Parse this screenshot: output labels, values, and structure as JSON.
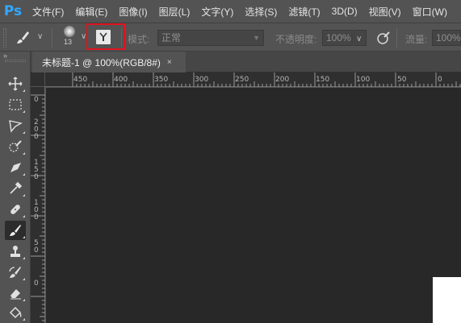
{
  "app": {
    "logo": "Ps"
  },
  "menu": [
    "文件(F)",
    "编辑(E)",
    "图像(I)",
    "图层(L)",
    "文字(Y)",
    "选择(S)",
    "滤镜(T)",
    "3D(D)",
    "视图(V)",
    "窗口(W)"
  ],
  "options": {
    "brush_size": "13",
    "mode_label": "模式:",
    "mode_value": "正常",
    "opacity_label": "不透明度:",
    "opacity_value": "100%",
    "flow_label": "流量:",
    "flow_value": "100%"
  },
  "document": {
    "tab_title": "未标题-1 @ 100%(RGB/8#)",
    "close": "×"
  },
  "ruler": {
    "h_labels": [
      "450",
      "400",
      "350",
      "300",
      "250",
      "200",
      "150",
      "100",
      "50",
      "0"
    ],
    "v_labels": [
      "0",
      "200",
      "150",
      "100",
      "50",
      "0"
    ]
  },
  "toolbar_collapse": "»",
  "tools": [
    "move-tool",
    "marquee-tool",
    "lasso-tool",
    "quick-selection-tool",
    "crop-tool",
    "eyedropper-tool",
    "healing-brush-tool",
    "brush-tool",
    "clone-stamp-tool",
    "history-brush-tool",
    "eraser-tool",
    "paint-bucket-tool"
  ],
  "colors": {
    "ui_bg": "#535353",
    "canvas_bg": "#282828",
    "highlight": "#e0141e",
    "ps_blue": "#31a8ff"
  }
}
